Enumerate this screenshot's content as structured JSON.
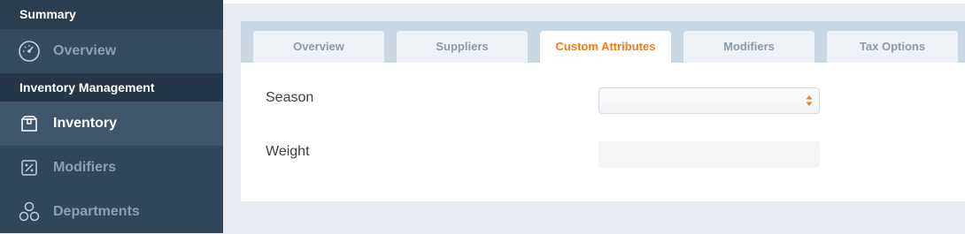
{
  "sidebar": {
    "sections": [
      {
        "label": "Summary"
      },
      {
        "label": "Inventory Management"
      }
    ],
    "items": [
      {
        "label": "Overview",
        "icon": "gauge-icon"
      },
      {
        "label": "Inventory",
        "icon": "box-icon",
        "active": true
      },
      {
        "label": "Modifiers",
        "icon": "percent-icon"
      },
      {
        "label": "Departments",
        "icon": "departments-icon"
      }
    ]
  },
  "tabs": [
    {
      "label": "Overview"
    },
    {
      "label": "Suppliers"
    },
    {
      "label": "Custom Attributes",
      "active": true
    },
    {
      "label": "Modifiers"
    },
    {
      "label": "Tax Options"
    }
  ],
  "form": {
    "season_label": "Season",
    "season_value": "",
    "weight_label": "Weight",
    "weight_value": ""
  },
  "colors": {
    "accent": "#f07d19",
    "sidebar_bg": "#2f475c",
    "sidebar_active": "#3e576c"
  }
}
